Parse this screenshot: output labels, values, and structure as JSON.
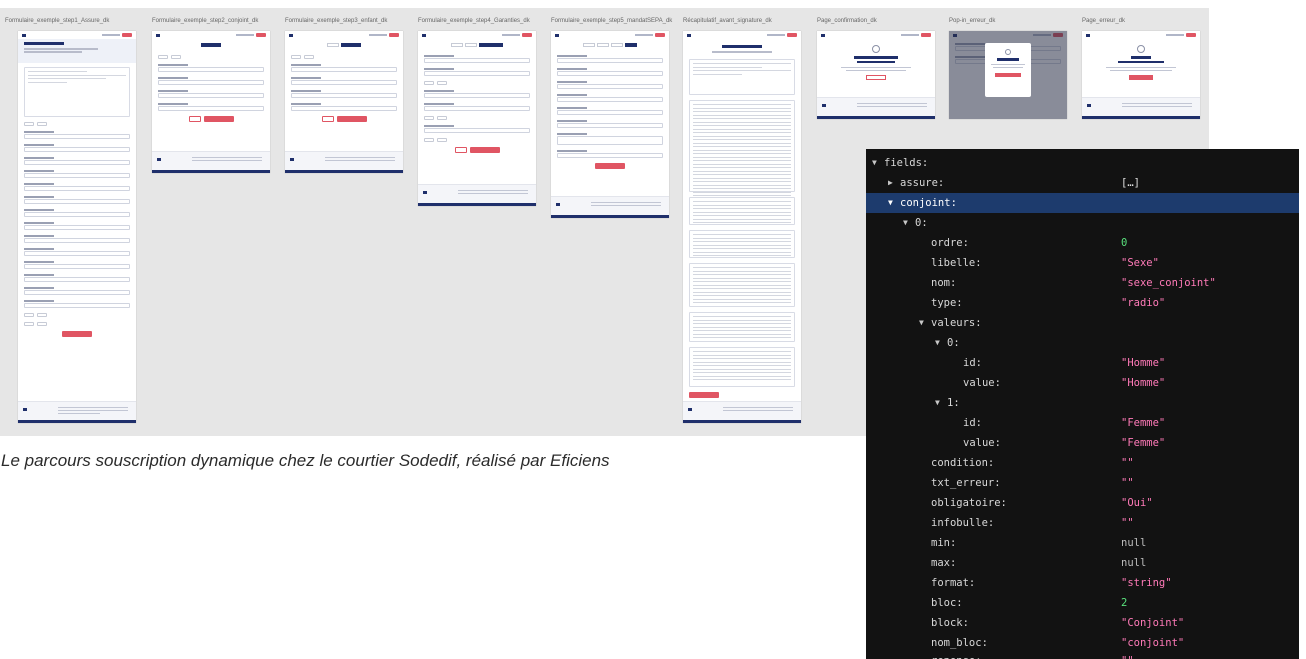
{
  "frames": [
    {
      "label": "Formulaire_exemple_step1_Assure_dk"
    },
    {
      "label": "Formulaire_exemple_step2_conjoint_dk"
    },
    {
      "label": "Formulaire_exemple_step3_enfant_dk"
    },
    {
      "label": "Formulaire_exemple_step4_Garanties_dk"
    },
    {
      "label": "Formulaire_exemple_step5_mandatSEPA_dk"
    },
    {
      "label": "Récapitulatif_avant_signature_dk"
    },
    {
      "label": "Page_confirmation_dk"
    },
    {
      "label": "Pop-in_erreur_dk"
    },
    {
      "label": "Page_erreur_dk"
    }
  ],
  "caption": "Le parcours souscription dynamique chez le courtier Sodedif, réalisé par Eficiens",
  "inspector": {
    "root_key": "fields:",
    "assure_key": "assure:",
    "assure_value": "[…]",
    "conjoint_key": "conjoint:",
    "item_index": "0:",
    "ordre_key": "ordre:",
    "ordre_value": "0",
    "libelle_key": "libelle:",
    "libelle_value": "\"Sexe\"",
    "nom_key": "nom:",
    "nom_value": "\"sexe_conjoint\"",
    "type_key": "type:",
    "type_value": "\"radio\"",
    "valeurs_key": "valeurs:",
    "v0_index": "0:",
    "v0_id_key": "id:",
    "v0_id_value": "\"Homme\"",
    "v0_value_key": "value:",
    "v0_value_value": "\"Homme\"",
    "v1_index": "1:",
    "v1_id_key": "id:",
    "v1_id_value": "\"Femme\"",
    "v1_value_key": "value:",
    "v1_value_value": "\"Femme\"",
    "condition_key": "condition:",
    "condition_value": "\"\"",
    "txt_erreur_key": "txt_erreur:",
    "txt_erreur_value": "\"\"",
    "obligatoire_key": "obligatoire:",
    "obligatoire_value": "\"Oui\"",
    "infobulle_key": "infobulle:",
    "infobulle_value": "\"\"",
    "min_key": "min:",
    "min_value": "null",
    "max_key": "max:",
    "max_value": "null",
    "format_key": "format:",
    "format_value": "\"string\"",
    "bloc_key": "bloc:",
    "bloc_value": "2",
    "block_key": "block:",
    "block_value": "\"Conjoint\"",
    "nom_bloc_key": "nom_bloc:",
    "nom_bloc_value": "\"conjoint\"",
    "reponse_key": "reponse:",
    "reponse_value": "\"\""
  },
  "colors": {
    "brand_navy": "#1f2f6b",
    "brand_red": "#e05563",
    "inspector_bg": "#121212",
    "selected_row": "#1d3b6d",
    "json_string": "#ff7ab8",
    "json_number": "#59e07c"
  }
}
